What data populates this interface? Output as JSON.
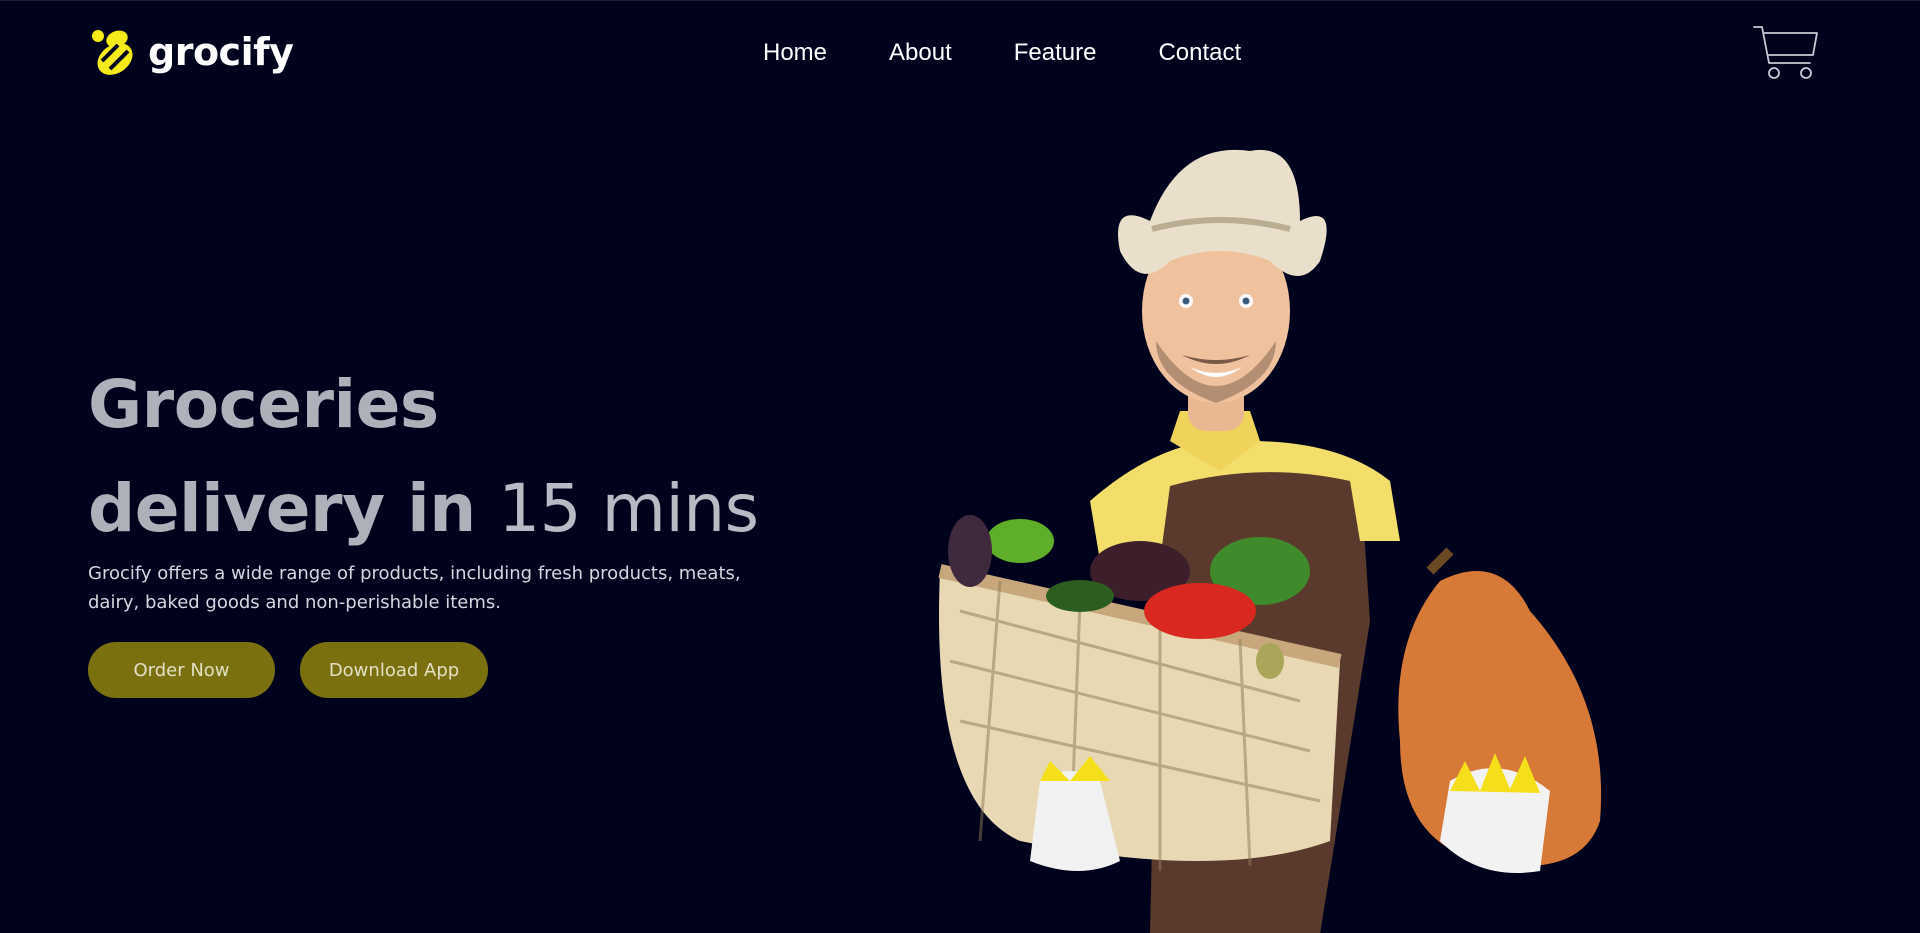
{
  "brand": {
    "name": "grocify",
    "logo_icon": "bee-logo-icon",
    "accent_color": "#f5eb1a"
  },
  "nav": {
    "items": [
      {
        "label": "Home"
      },
      {
        "label": "About"
      },
      {
        "label": "Feature"
      },
      {
        "label": "Contact"
      }
    ]
  },
  "header": {
    "cart_icon": "shopping-cart-icon"
  },
  "hero": {
    "title_line1": "Groceries",
    "title_line2_bold": "delivery in",
    "title_line2_light": "15 mins",
    "description": "Grocify offers a wide range of products, including fresh products, meats, dairy, baked goods and non-perishable items.",
    "buttons": {
      "order": "Order Now",
      "download": "Download App"
    },
    "button_color": "#7a7010",
    "image_subject": "farmer-with-vegetable-basket"
  },
  "colors": {
    "background": "#00021c",
    "title": "#aeb0ba"
  }
}
